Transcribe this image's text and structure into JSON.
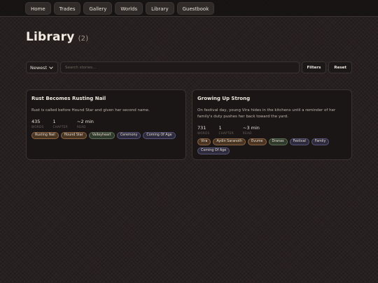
{
  "nav": {
    "items": [
      {
        "label": "Home"
      },
      {
        "label": "Trades"
      },
      {
        "label": "Gallery"
      },
      {
        "label": "Worlds"
      },
      {
        "label": "Library"
      },
      {
        "label": "Guestbook"
      }
    ]
  },
  "page": {
    "title": "Library",
    "count": "(2)"
  },
  "toolbar": {
    "sort_value": "Newest",
    "search_placeholder": "Search stories...",
    "filters_label": "Filters",
    "reset_label": "Reset"
  },
  "colors": {
    "tag_character": "#4a3523",
    "tag_place": "#2f3a2c",
    "tag_theme": "#2c2a3c"
  },
  "stories": [
    {
      "title": "Rust Becomes Rusting Nail",
      "description": "Rust is called before Hound Star and given her second name.",
      "words": "435",
      "words_label": "WORDS",
      "chapters": "1",
      "chapters_label": "CHAPTER",
      "read": "~2 min",
      "read_label": "READ",
      "tags": [
        {
          "label": "Rusting Nail",
          "kind": "brown"
        },
        {
          "label": "Hound Star",
          "kind": "brown"
        },
        {
          "label": "Valleyheart",
          "kind": "green"
        },
        {
          "label": "Ceremony",
          "kind": "slate"
        },
        {
          "label": "Coming Of Age",
          "kind": "slate"
        }
      ]
    },
    {
      "title": "Growing Up Strong",
      "description": "On festival day, young Vira hides in the kitchens until a reminder of her family's duty pushes her back toward the yard.",
      "words": "731",
      "words_label": "WORDS",
      "chapters": "1",
      "chapters_label": "CHAPTER",
      "read": "~3 min",
      "read_label": "READ",
      "tags": [
        {
          "label": "Vira",
          "kind": "brown"
        },
        {
          "label": "Aydin Saranoth",
          "kind": "brown"
        },
        {
          "label": "Evume",
          "kind": "brown"
        },
        {
          "label": "Dranas",
          "kind": "green"
        },
        {
          "label": "Festival",
          "kind": "slate"
        },
        {
          "label": "Family",
          "kind": "slate"
        },
        {
          "label": "Coming Of Age",
          "kind": "slate"
        }
      ]
    }
  ]
}
